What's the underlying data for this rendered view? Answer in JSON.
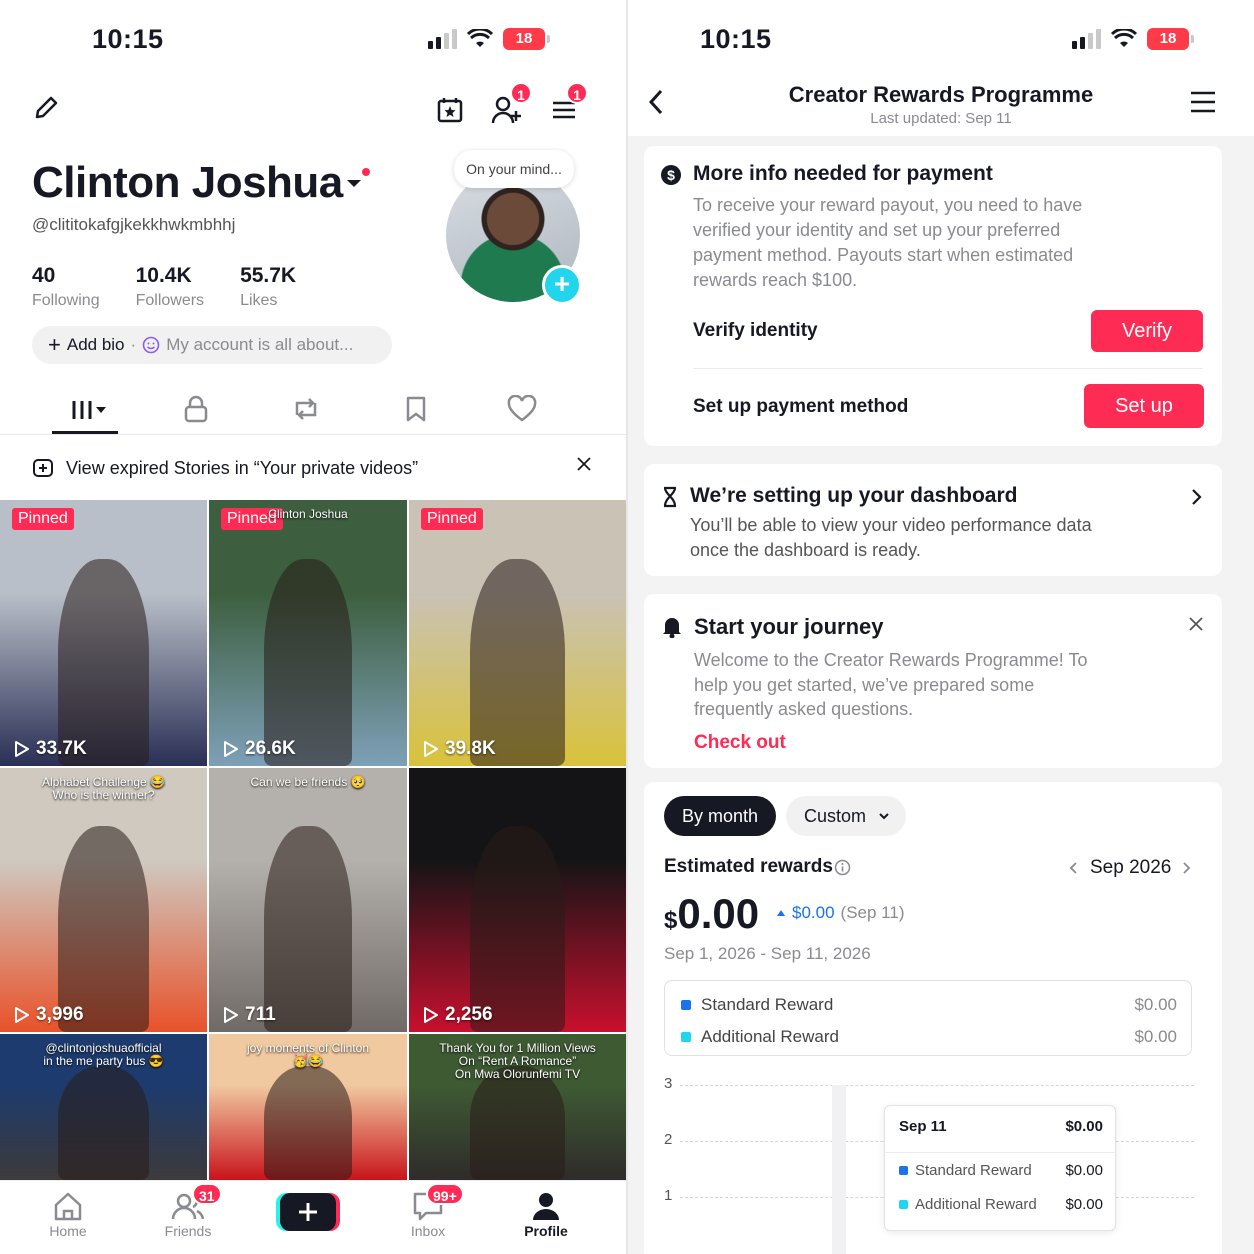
{
  "left": {
    "status": {
      "time": "10:15",
      "battery": "18"
    },
    "header": {
      "inbox_badge": "1",
      "menu_badge": "1"
    },
    "profile": {
      "name": "Clinton Joshua",
      "handle": "@clititokafgjkekkhwkmbhhj",
      "stats": [
        {
          "value": "40",
          "label": "Following"
        },
        {
          "value": "10.4K",
          "label": "Followers"
        },
        {
          "value": "55.7K",
          "label": "Likes"
        }
      ],
      "bio_add": "Add bio",
      "bio_placeholder": "My account is all about...",
      "mind_bubble": "On your mind..."
    },
    "stories_banner": "View expired Stories in “Your private videos”",
    "pinned_label": "Pinned",
    "videos": [
      {
        "views": "33.7K",
        "pinned": true,
        "overlay": "",
        "colors": [
          "#b9bfc8",
          "#2a2f55"
        ]
      },
      {
        "views": "26.6K",
        "pinned": true,
        "overlay": "Clinton Joshua",
        "colors": [
          "#3d5f3f",
          "#7ea0b8"
        ]
      },
      {
        "views": "39.8K",
        "pinned": true,
        "overlay": "",
        "colors": [
          "#c9c2b5",
          "#d9c23a"
        ]
      },
      {
        "views": "3,996",
        "pinned": false,
        "overlay": "Alphabet Challenge 😂\nWho is the winner?",
        "colors": [
          "#cfc9c0",
          "#e8522a"
        ]
      },
      {
        "views": "711",
        "pinned": false,
        "overlay": "Can we be friends 🥺",
        "colors": [
          "#b4b0ab",
          "#6f6a66"
        ]
      },
      {
        "views": "2,256",
        "pinned": false,
        "overlay": "",
        "colors": [
          "#141416",
          "#c8102e"
        ]
      },
      {
        "views": "",
        "pinned": false,
        "overlay": "@clintonjoshuaofficial\nin the me party bus 😎",
        "colors": [
          "#1d3b6e",
          "#3d3a3a"
        ]
      },
      {
        "views": "",
        "pinned": false,
        "overlay": "joy moments of Clinton\n🥳😂",
        "colors": [
          "#f0c9a0",
          "#c8141c"
        ]
      },
      {
        "views": "",
        "pinned": false,
        "overlay": "Thank You for 1 Million Views\nOn “Rent A Romance”\nOn Mwa Olorunfemi TV",
        "colors": [
          "#3e5a33",
          "#2f2b2a"
        ]
      }
    ],
    "nav": [
      {
        "label": "Home",
        "badge": ""
      },
      {
        "label": "Friends",
        "badge": "31"
      },
      {
        "label": "",
        "badge": ""
      },
      {
        "label": "Inbox",
        "badge": "99+"
      },
      {
        "label": "Profile",
        "badge": ""
      }
    ]
  },
  "right": {
    "status": {
      "time": "10:15",
      "battery": "18"
    },
    "header": {
      "title": "Creator Rewards Programme",
      "subtitle": "Last updated: Sep 11"
    },
    "payment_card": {
      "title": "More info needed for payment",
      "body": "To receive your reward payout, you need to have verified your identity and set up your preferred payment method. Payouts start when estimated rewards reach $100.",
      "verify_label": "Verify identity",
      "verify_button": "Verify",
      "setup_label": "Set up payment method",
      "setup_button": "Set up"
    },
    "dashboard_card": {
      "title": "We’re setting up your dashboard",
      "body": "You’ll be able to view your video performance data once the dashboard is ready."
    },
    "journey_card": {
      "title": "Start your journey",
      "body": "Welcome to the Creator Rewards Programme! To help you get started, we’ve prepared some frequently asked questions.",
      "link": "Check out"
    },
    "rewards": {
      "by_month": "By month",
      "custom": "Custom",
      "title": "Estimated rewards",
      "period": "Sep 2026",
      "currency": "$",
      "amount": "0.00",
      "change": "$0.00",
      "change_date": "(Sep 11)",
      "date_range": "Sep 1, 2026 - Sep 11, 2026",
      "legend": [
        {
          "name": "Standard Reward",
          "value": "$0.00",
          "color": "#1a73e8"
        },
        {
          "name": "Additional Reward",
          "value": "$0.00",
          "color": "#20d5ec"
        }
      ],
      "y_ticks": [
        "3",
        "2",
        "1"
      ],
      "tooltip": {
        "date": "Sep 11",
        "total": "$0.00"
      }
    }
  }
}
